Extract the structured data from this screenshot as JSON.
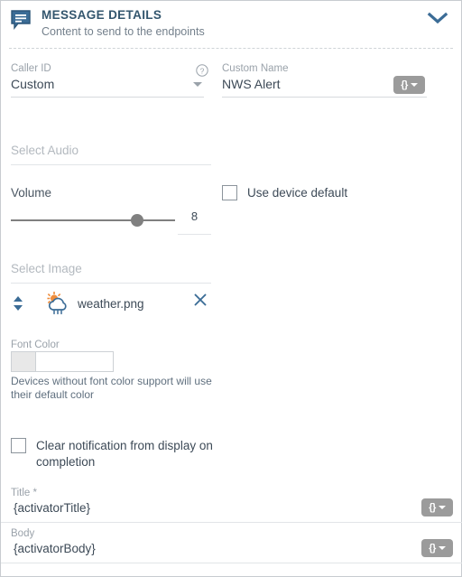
{
  "header": {
    "icon": "message-bubble-icon",
    "title": "MESSAGE DETAILS",
    "subtitle": "Content to send to the endpoints",
    "collapse_icon": "chevron-down-icon",
    "accent_color": "#33566e"
  },
  "caller_id": {
    "label": "Caller ID",
    "value": "Custom",
    "help_icon": "help-circle-icon",
    "caret_icon": "chevron-down-icon"
  },
  "custom_name": {
    "label": "Custom Name",
    "value": "NWS Alert",
    "variable_button": "{}"
  },
  "select_audio": {
    "placeholder": "Select Audio"
  },
  "volume": {
    "label": "Volume",
    "value": "8",
    "slider_percent": 77,
    "min": 0,
    "max": 10
  },
  "use_device_default": {
    "label": "Use device default",
    "checked": false
  },
  "select_image": {
    "placeholder": "Select Image",
    "reorder_icon": "sort-updown-icon",
    "file_icon": "weather-sun-cloud-rain-icon",
    "file_name": "weather.png",
    "remove_icon": "close-x-icon"
  },
  "font_color": {
    "label": "Font Color",
    "swatch_color": "#e8e8e8",
    "value": "",
    "note": "Devices without font color support will use their default color"
  },
  "clear_notification": {
    "label": "Clear notification from display on completion",
    "checked": false
  },
  "title_field": {
    "label": "Title *",
    "value": "{activatorTitle}",
    "variable_button": "{}"
  },
  "body_field": {
    "label": "Body",
    "value": "{activatorBody}",
    "variable_button": "{}"
  }
}
